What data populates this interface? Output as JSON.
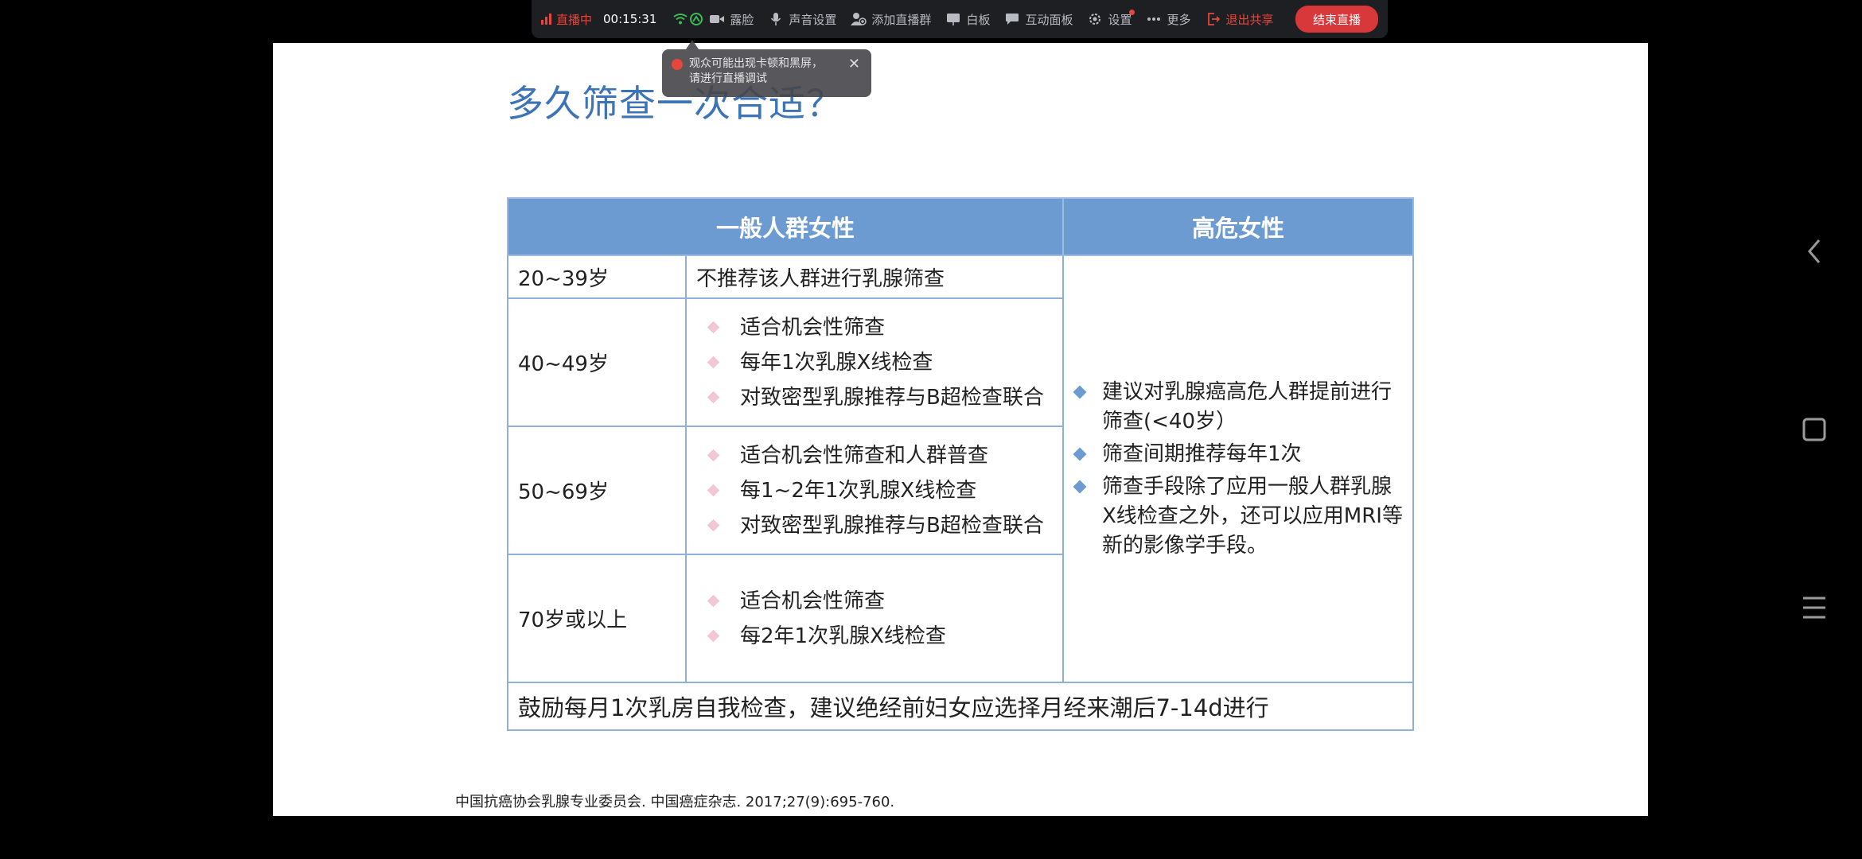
{
  "toolbar": {
    "live_label": "直播中",
    "timer": "00:15:31",
    "items": [
      {
        "label": "露脸",
        "icon": "camera-icon"
      },
      {
        "label": "声音设置",
        "icon": "microphone-icon"
      },
      {
        "label": "添加直播群",
        "icon": "add-group-icon"
      },
      {
        "label": "白板",
        "icon": "whiteboard-icon"
      },
      {
        "label": "互动面板",
        "icon": "chat-icon"
      },
      {
        "label": "设置",
        "icon": "gear-icon"
      },
      {
        "label": "更多",
        "icon": "more-icon"
      }
    ],
    "exit_share_label": "退出共享",
    "end_live_label": "结束直播",
    "accent_color": "#e8453c"
  },
  "popup": {
    "line1": "观众可能出现卡顿和黑屏，",
    "line2": "请进行直播调试",
    "close_symbol": "✕"
  },
  "slide": {
    "title": "多久筛查一次合适？",
    "table": {
      "header_general": "一般人群女性",
      "header_high_risk": "高危女性",
      "rows": [
        {
          "age": "20~39岁",
          "text": "不推荐该人群进行乳腺筛查"
        },
        {
          "age": "40~49岁",
          "items": [
            "适合机会性筛查",
            "每年1次乳腺X线检查",
            "对致密型乳腺推荐与B超检查联合"
          ]
        },
        {
          "age": "50~69岁",
          "items": [
            "适合机会性筛查和人群普查",
            "每1~2年1次乳腺X线检查",
            "对致密型乳腺推荐与B超检查联合"
          ]
        },
        {
          "age": "70岁或以上",
          "items": [
            "适合机会性筛查",
            "每2年1次乳腺X线检查"
          ]
        }
      ],
      "high_risk_items": [
        "建议对乳腺癌高危人群提前进行筛查(<40岁）",
        "筛查间期推荐每年1次",
        "筛查手段除了应用一般人群乳腺X线检查之外，还可以应用MRI等新的影像学手段。"
      ],
      "footer": "鼓励每月1次乳房自我检查，建议绝经前妇女应选择月经来潮后7-14d进行"
    },
    "citation": "中国抗癌协会乳腺专业委员会. 中国癌症杂志. 2017;27(9):695-760.",
    "header_color": "#6c9bd1",
    "title_color": "#3c74b7"
  },
  "nav": [
    {
      "icon": "back-icon"
    },
    {
      "icon": "home-icon"
    },
    {
      "icon": "menu-icon"
    }
  ]
}
